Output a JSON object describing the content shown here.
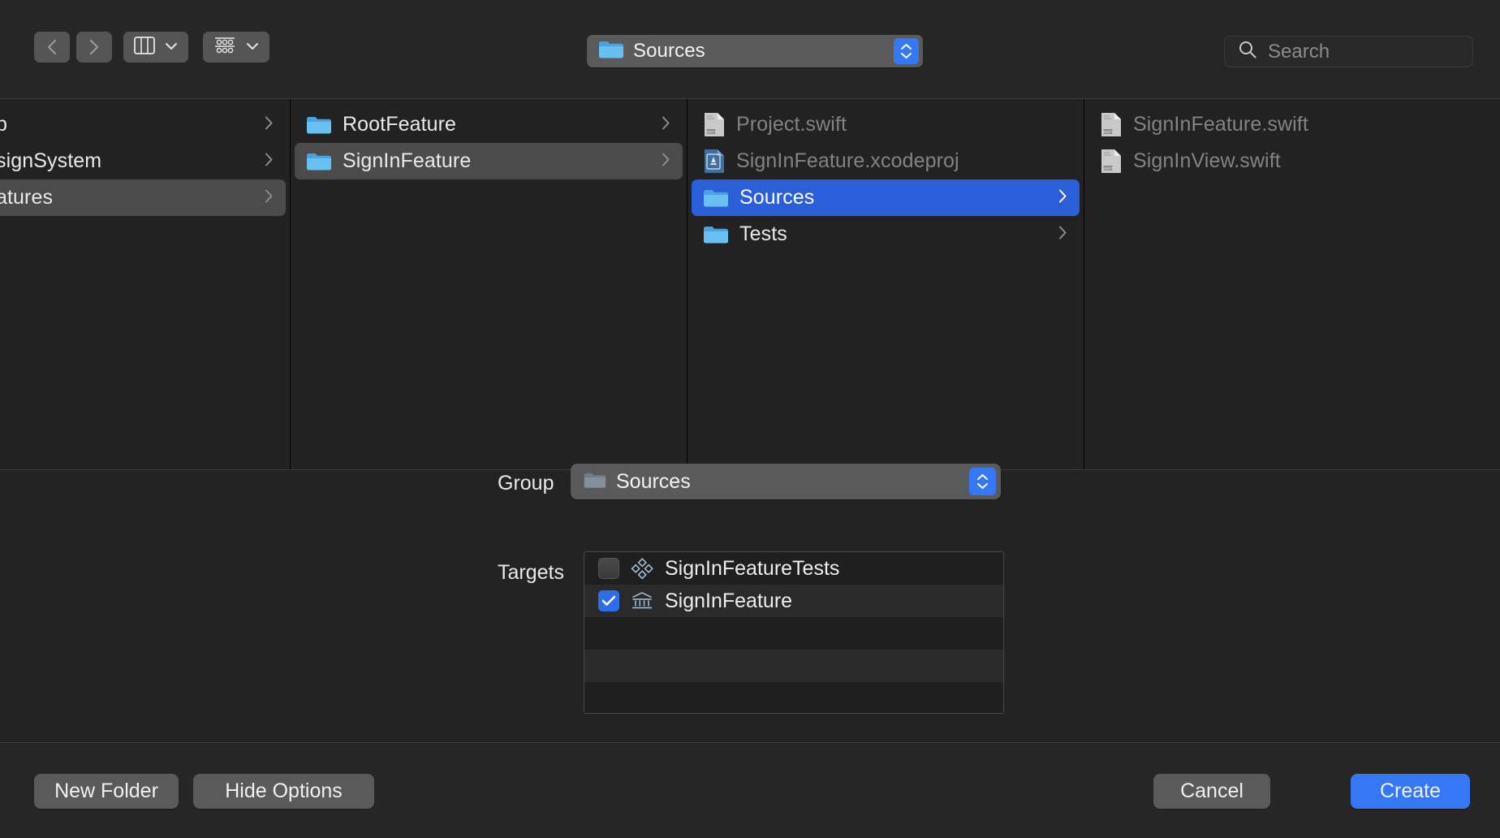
{
  "toolbar": {
    "back_icon": "chevron-left-icon",
    "forward_icon": "chevron-right-icon",
    "view_mode_icon": "column-view-icon",
    "group_mode_icon": "grid-view-icon",
    "path_value": "Sources",
    "search_placeholder": "Search"
  },
  "browser": {
    "columns": [
      {
        "name": "column-1",
        "items": [
          {
            "label": "p",
            "kind": "folder",
            "state": "normal",
            "has_chevron": true
          },
          {
            "label": "signSystem",
            "kind": "folder",
            "state": "normal",
            "has_chevron": true
          },
          {
            "label": "atures",
            "kind": "folder",
            "state": "selected-inactive",
            "has_chevron": true
          }
        ]
      },
      {
        "name": "column-2",
        "items": [
          {
            "label": "RootFeature",
            "kind": "folder",
            "state": "normal",
            "has_chevron": true
          },
          {
            "label": "SignInFeature",
            "kind": "folder",
            "state": "selected-inactive",
            "has_chevron": true
          }
        ]
      },
      {
        "name": "column-3",
        "items": [
          {
            "label": "Project.swift",
            "kind": "swift-file",
            "state": "disabled",
            "has_chevron": false
          },
          {
            "label": "SignInFeature.xcodeproj",
            "kind": "xcodeproj-file",
            "state": "disabled",
            "has_chevron": false
          },
          {
            "label": "Sources",
            "kind": "folder",
            "state": "selected-active",
            "has_chevron": true
          },
          {
            "label": "Tests",
            "kind": "folder",
            "state": "normal",
            "has_chevron": true
          }
        ]
      },
      {
        "name": "column-4",
        "items": [
          {
            "label": "SignInFeature.swift",
            "kind": "swift-file",
            "state": "disabled",
            "has_chevron": false
          },
          {
            "label": "SignInView.swift",
            "kind": "swift-file",
            "state": "disabled",
            "has_chevron": false
          }
        ]
      }
    ]
  },
  "options": {
    "group_label": "Group",
    "group_value": "Sources",
    "targets_label": "Targets",
    "targets": [
      {
        "label": "SignInFeatureTests",
        "checked": false,
        "icon": "test-bundle-icon"
      },
      {
        "label": "SignInFeature",
        "checked": true,
        "icon": "framework-icon"
      }
    ]
  },
  "footer": {
    "new_folder_label": "New Folder",
    "hide_options_label": "Hide Options",
    "cancel_label": "Cancel",
    "create_label": "Create"
  },
  "colors": {
    "accent_blue": "#3478f6",
    "selection_blue": "#2b5fd9",
    "selection_grey": "#4b4b4b",
    "window_background": "#232323",
    "browser_background": "#222222"
  }
}
